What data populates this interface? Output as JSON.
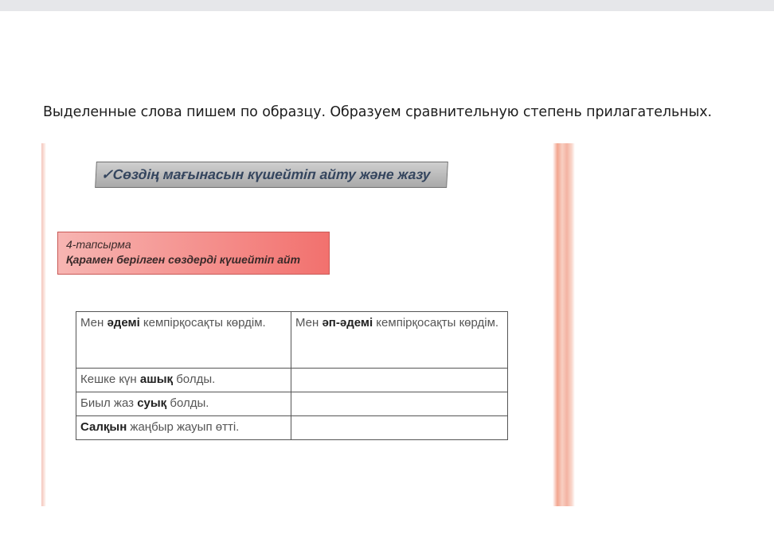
{
  "instruction": "Выделенные слова пишем по образцу. Образуем сравнительную степень прилагательных.",
  "worksheet": {
    "banner": "✓Сөздің мағынасын күшейтіп айту және  жазу",
    "task_number": "4-тапсырма",
    "task_text": "Қарамен берілген сөздерді күшейтіп айт",
    "rows": [
      {
        "left_pre": "Мен ",
        "left_bold": "әдемі",
        "left_post": " кемпірқосақты көрдім.",
        "right_pre": "Мен ",
        "right_bold": "әп-әдемі",
        "right_post": " кемпірқосақты көрдім."
      },
      {
        "left_pre": "Кешке күн ",
        "left_bold": "ашық",
        "left_post": " болды.",
        "right_pre": "",
        "right_bold": "",
        "right_post": ""
      },
      {
        "left_pre": "Биыл жаз ",
        "left_bold": "суық",
        "left_post": " болды.",
        "right_pre": "",
        "right_bold": "",
        "right_post": ""
      },
      {
        "left_pre": "",
        "left_bold": "Салқын",
        "left_post": " жаңбыр жауып өтті.",
        "right_pre": "",
        "right_bold": "",
        "right_post": ""
      }
    ]
  }
}
